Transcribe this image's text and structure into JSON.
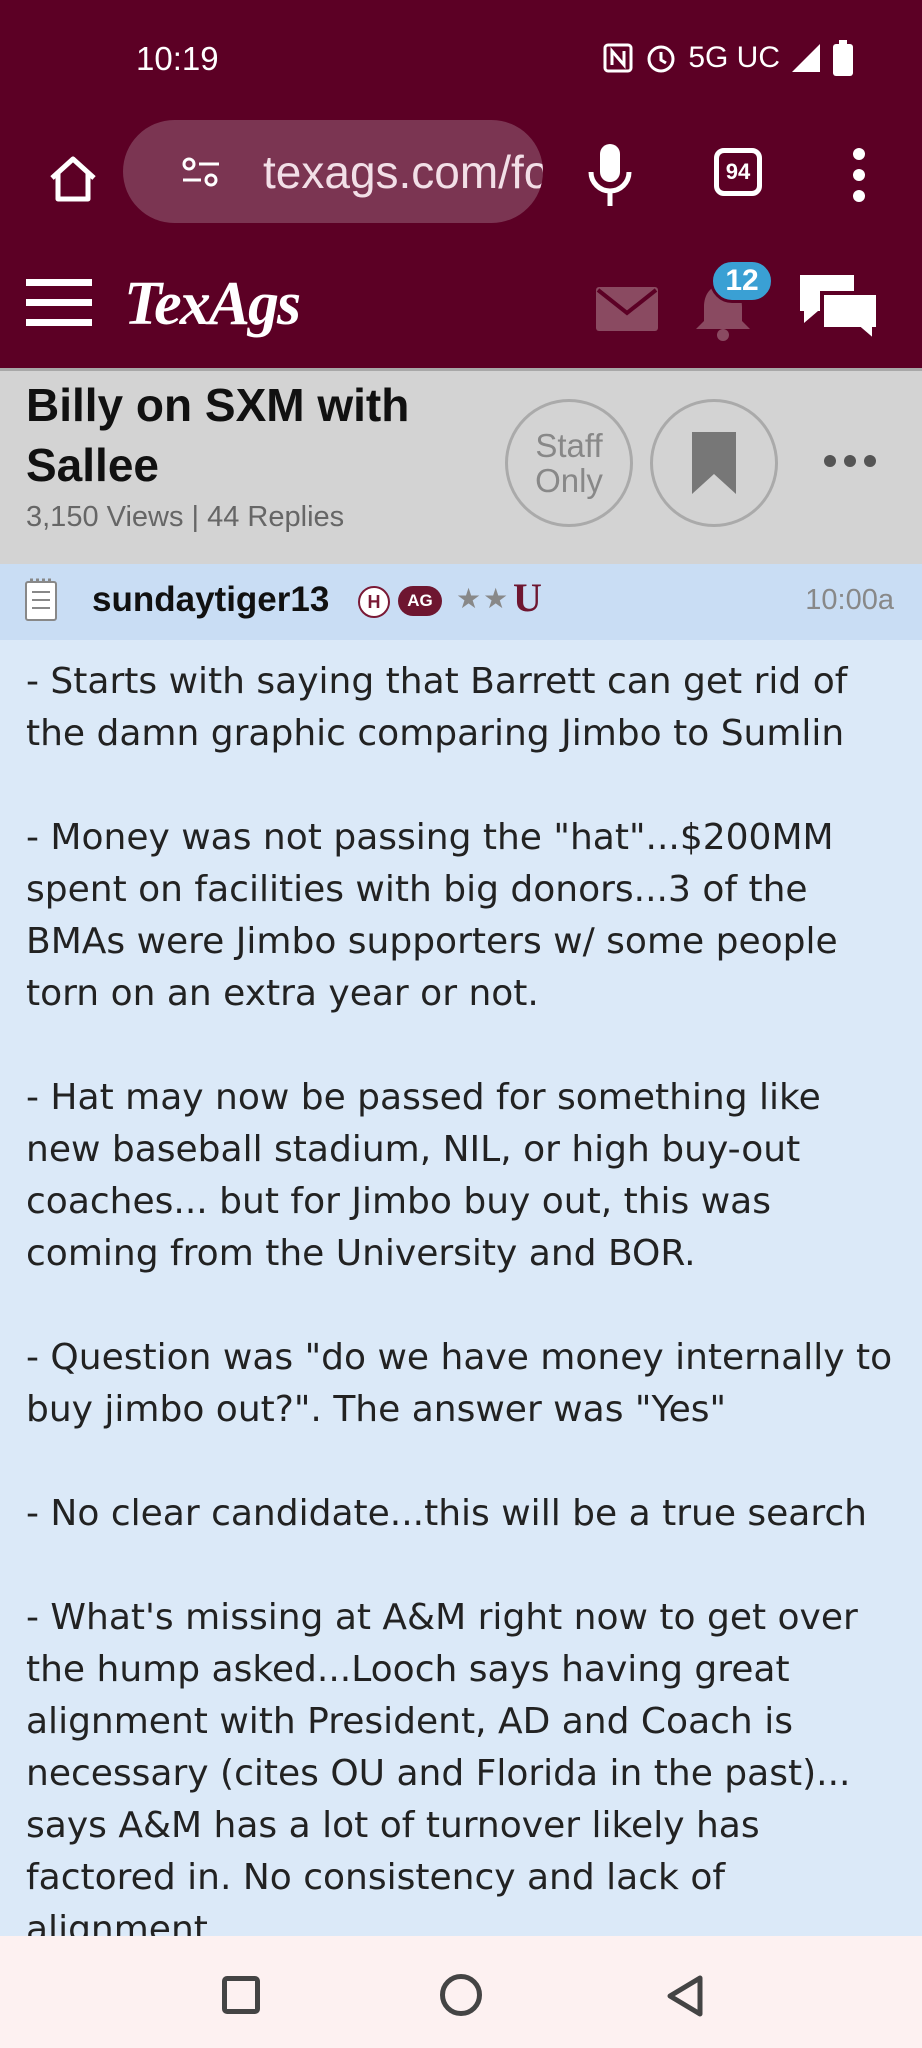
{
  "status": {
    "time": "10:19",
    "network": "5G UC",
    "icons": [
      "nfc-icon",
      "alarm-icon",
      "signal-icon",
      "battery-icon"
    ]
  },
  "browser": {
    "url": "texags.com/forums",
    "tab_count": "94"
  },
  "header": {
    "logo": "TexAgs",
    "notification_count": "12"
  },
  "thread": {
    "title": "Billy on SXM with Sallee",
    "stats": "3,150 Views | 44 Replies",
    "staff_only_label": "Staff Only"
  },
  "post": {
    "username": "sundaytiger13",
    "badge_h": "H",
    "badge_ag": "AG",
    "stars": "★★",
    "school_logo": "U",
    "time": "10:00a",
    "paragraphs": [
      "- Starts with saying that Barrett can get rid of the damn graphic comparing Jimbo to Sumlin",
      "- Money was not passing the \"hat\"...$200MM spent on facilities with big donors...3 of the BMAs were Jimbo supporters w/ some people torn on an extra year or not.",
      "- Hat may now be passed for something like new baseball stadium, NIL, or high buy-out coaches... but for Jimbo buy out, this was coming from the University and BOR.",
      "- Question was \"do we have money internally to buy jimbo out?\". The answer was \"Yes\"",
      "- No clear candidate...this will be a true search",
      "- What's missing at A&M right now to get over the hump asked...Looch says having great alignment with President, AD and Coach is necessary (cites OU and Florida in the past)... says A&M has a lot of turnover likely has factored in. No consistency and lack of alignment."
    ]
  },
  "colors": {
    "maroon": "#5c0025",
    "post_bg": "#dbe9f8",
    "badge_blue": "#3aa0d4"
  }
}
